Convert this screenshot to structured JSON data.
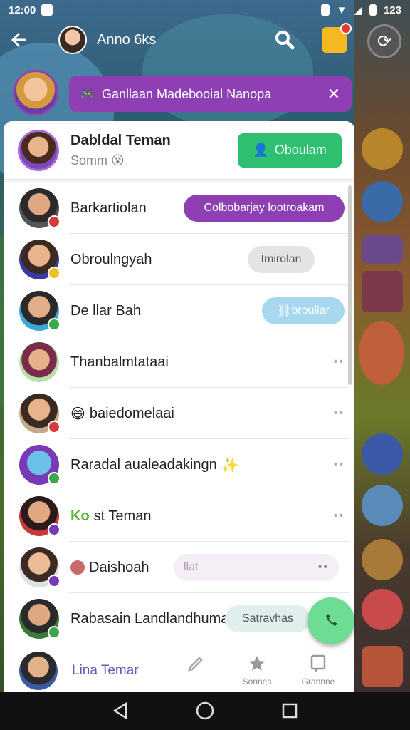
{
  "status_bar": {
    "time": "12:00",
    "right_text": "123"
  },
  "app_bar": {
    "title": "Anno 6ks",
    "back_icon": "arrow-left-icon",
    "search_icon": "search-icon",
    "notification_icon": "notification-icon",
    "sync_icon": "sync-icon"
  },
  "banner": {
    "text": "Ganllaan Madebooial Nanopa",
    "close_label": "✕",
    "icon": "game-controller-icon"
  },
  "panel_header": {
    "title": "Dabldal Teman",
    "subtitle": "Somm",
    "button_label": "Oboulam"
  },
  "rows": [
    {
      "name": "Barkartiolan",
      "action": {
        "type": "pill-purple",
        "label": "Colbobarjay lootroakam"
      }
    },
    {
      "name": "Obroulngyah",
      "action": {
        "type": "pill-grey",
        "label": "Imirolan"
      }
    },
    {
      "name": "De  llar Bah",
      "action": {
        "type": "pill-blue",
        "label": "brouliar"
      }
    },
    {
      "name": "Thanbalmtataai",
      "action": {
        "type": "dots",
        "label": "••"
      }
    },
    {
      "name": "baiedomelaai",
      "prefix_emoji": "😄",
      "action": {
        "type": "dots",
        "label": "••"
      }
    },
    {
      "name": "Raradal aualeadakingn",
      "suffix_emoji": "✨",
      "action": {
        "type": "dots",
        "label": "••"
      }
    },
    {
      "name": "st Teman",
      "prefix_text": "Ko",
      "action": {
        "type": "dots",
        "label": "••"
      }
    },
    {
      "name": "Daishoah",
      "action": {
        "type": "pill-light",
        "label": "llat"
      }
    },
    {
      "name": "Rabasain Landlandhumah",
      "action": {
        "type": "pill-teal",
        "label": "Satravhas"
      }
    }
  ],
  "tab_bar": {
    "active_label": "Lina Temar",
    "items": [
      {
        "label": "",
        "icon": "pencil-icon"
      },
      {
        "label": "Sonnes",
        "icon": "star-icon"
      },
      {
        "label": "Grannne",
        "icon": "message-icon"
      }
    ]
  },
  "colors": {
    "accent_purple": "#8e3fb3",
    "accent_green": "#2fbf71",
    "fab_green": "#6fdc94"
  }
}
